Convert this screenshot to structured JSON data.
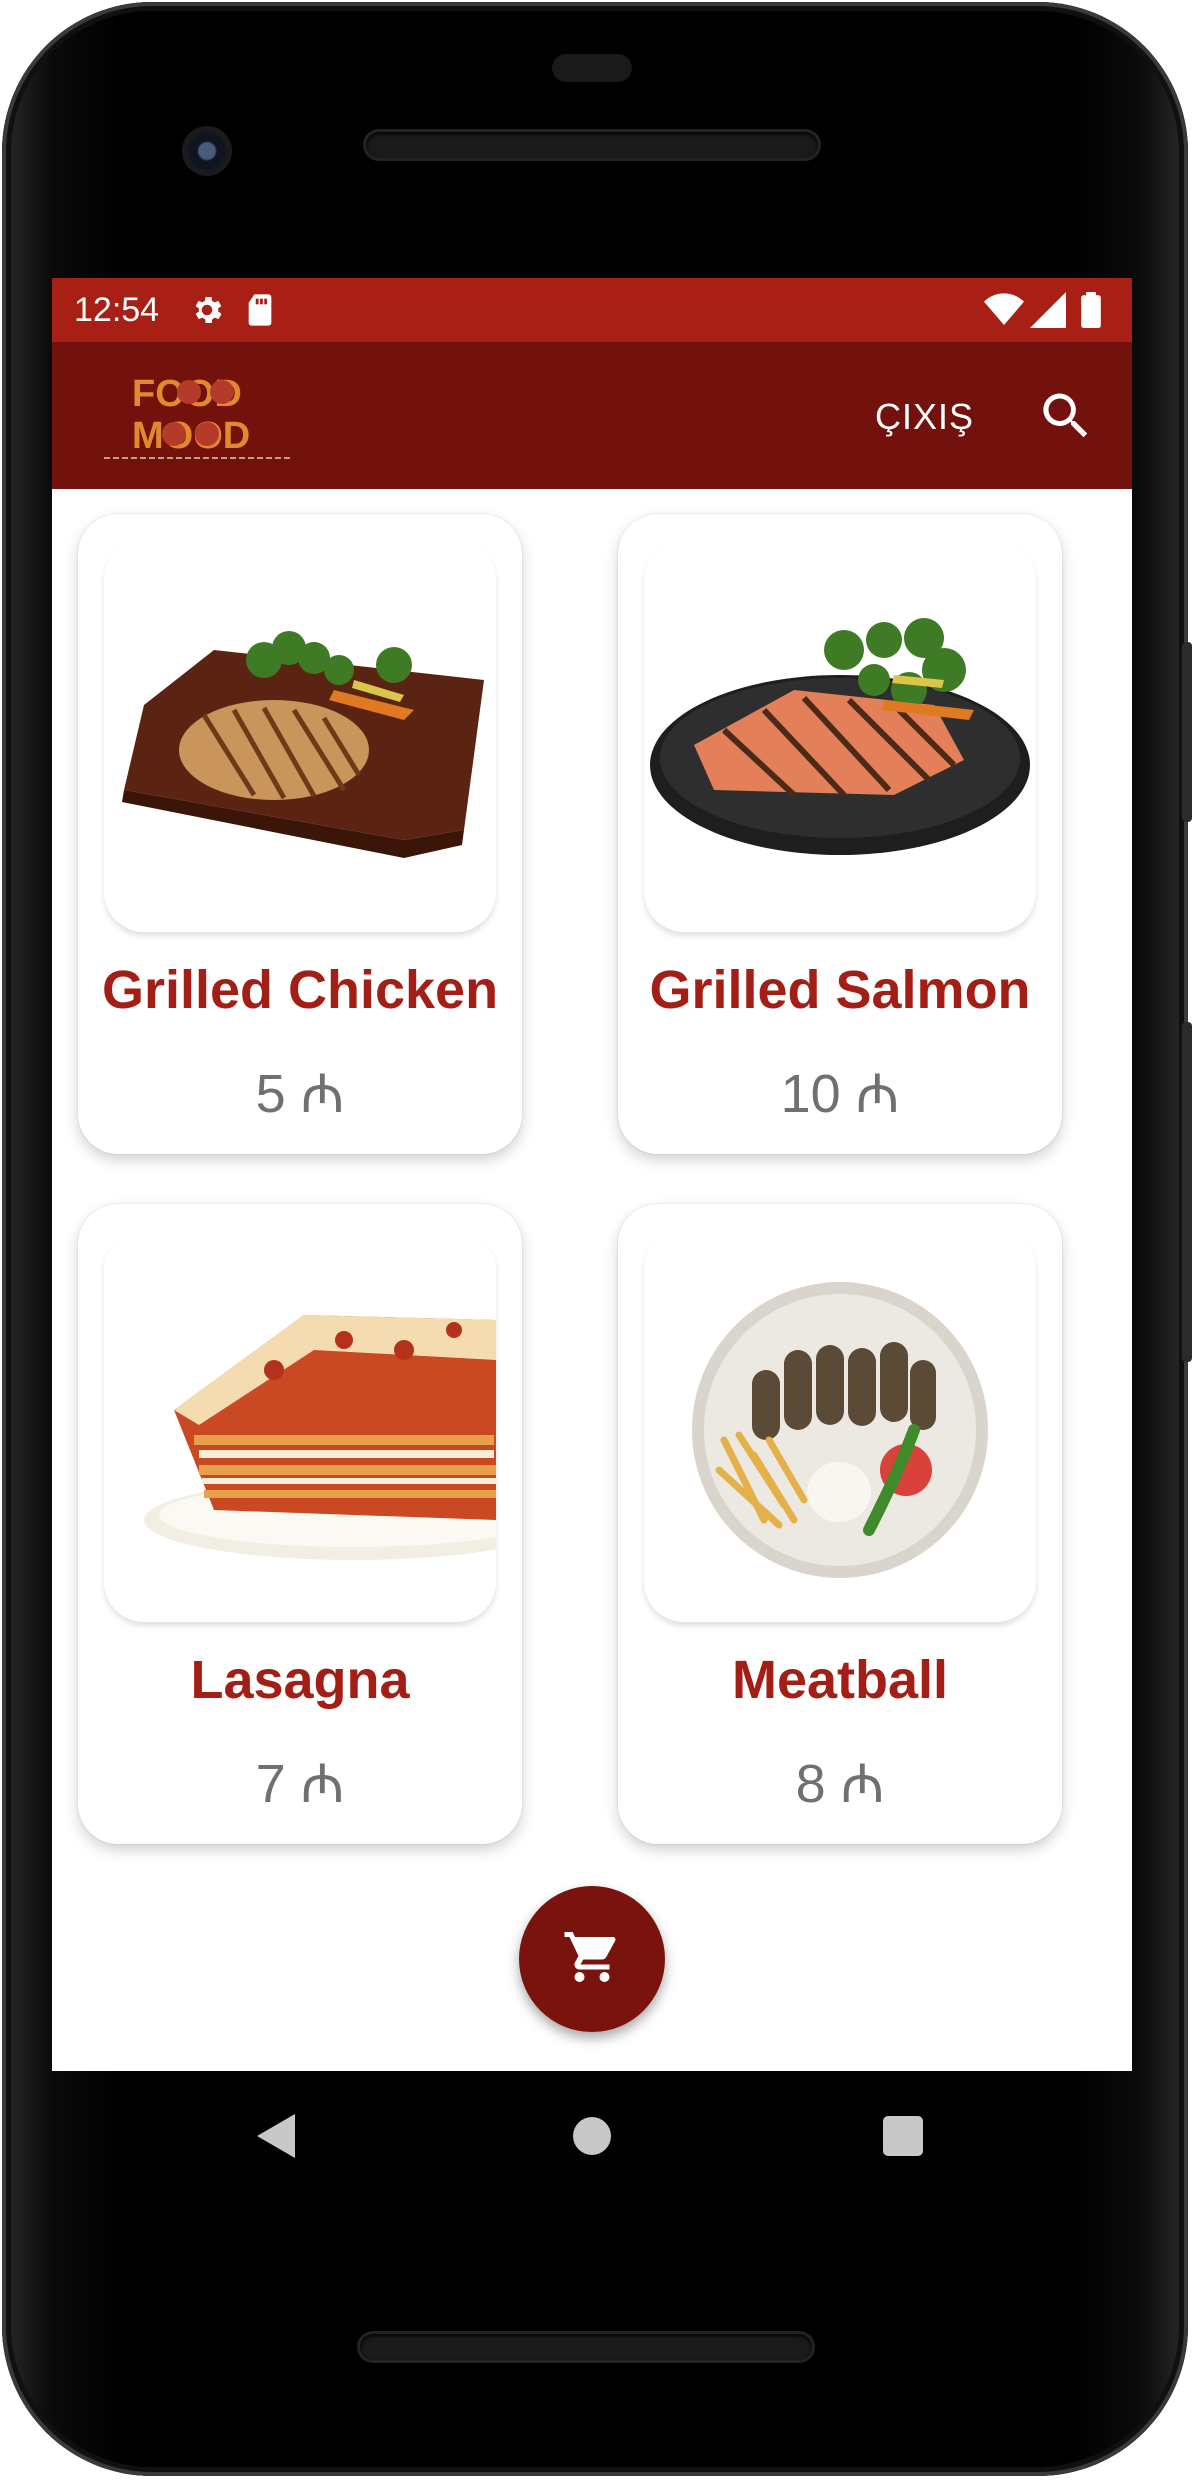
{
  "status_bar": {
    "time": "12:54",
    "icons": [
      "gear-icon",
      "sd-card-icon",
      "wifi-icon",
      "signal-icon",
      "battery-icon"
    ],
    "color": "#a81f15"
  },
  "app_bar": {
    "logo_line1": "FOOD",
    "logo_line2": "MOOD",
    "exit_label": "ÇIXIŞ",
    "search_icon": "search-icon",
    "color": "#73120d"
  },
  "products": [
    {
      "name": "Grilled Chicken",
      "price": "5 ₼",
      "image": "grilled-chicken-image"
    },
    {
      "name": "Grilled Salmon",
      "price": "10 ₼",
      "image": "grilled-salmon-image"
    },
    {
      "name": "Lasagna",
      "price": "7 ₼",
      "image": "lasagna-image"
    },
    {
      "name": "Meatball",
      "price": "8 ₼",
      "image": "meatball-image"
    }
  ],
  "fab": {
    "icon": "cart-icon",
    "color": "#7a120d"
  },
  "nav": {
    "icons": [
      "back-icon",
      "home-icon",
      "recents-icon"
    ]
  },
  "colors": {
    "title": "#a31f16",
    "price": "#707070"
  }
}
